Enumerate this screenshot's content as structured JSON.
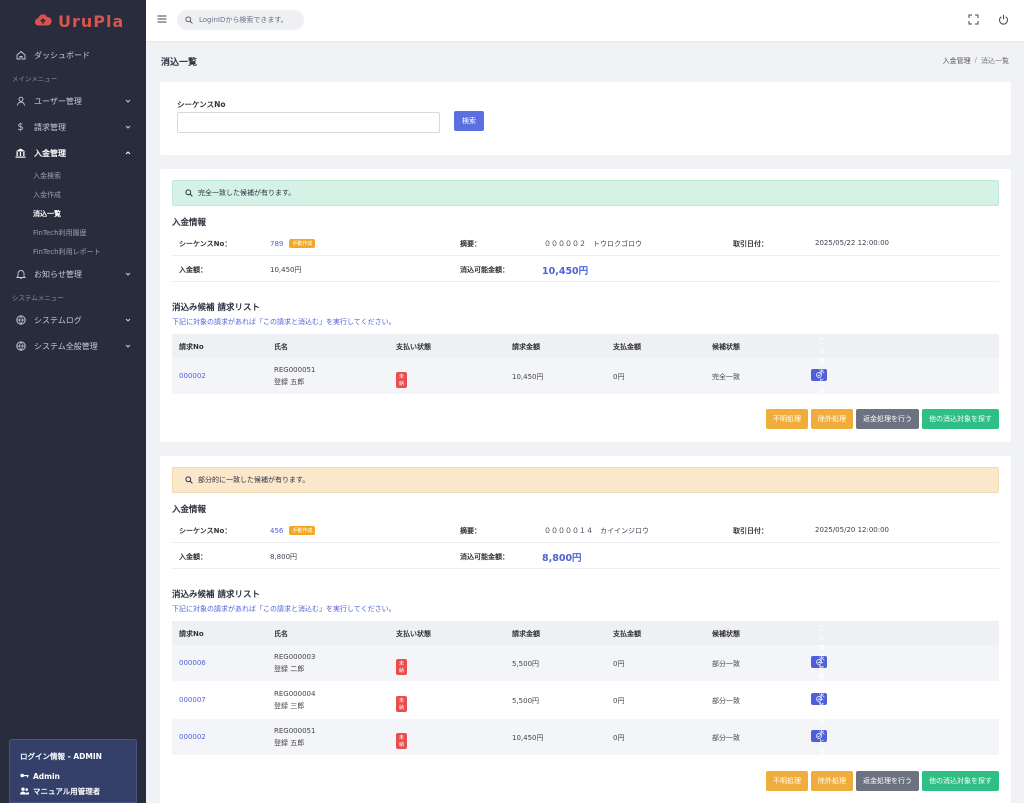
{
  "app": {
    "logo_text": "UruPla"
  },
  "sidebar": {
    "dashboard": "ダッシュボード",
    "section_main": "メインメニュー",
    "users": "ユーザー管理",
    "billing": "請求管理",
    "payments": "入金管理",
    "payments_sub": [
      "入金検索",
      "入金作成",
      "消込一覧",
      "FinTech利用履歴",
      "FinTech利用レポート"
    ],
    "notice": "お知らせ管理",
    "section_system": "システムメニュー",
    "syslog": "システムログ",
    "sysall": "システム全般管理",
    "login_title": "ログイン情報 - ADMIN",
    "login_user": "Admin",
    "login_role": "マニュアル用管理者"
  },
  "topbar": {
    "search_placeholder": "LoginIDから検索できます。"
  },
  "page": {
    "title": "消込一覧",
    "breadcrumb_parent": "入金管理",
    "breadcrumb_sep": "/",
    "breadcrumb_current": "消込一覧"
  },
  "search": {
    "label": "シーケンスNo",
    "button": "検索"
  },
  "common": {
    "info_title": "入金情報",
    "seq_label": "シーケンスNo：",
    "summary_label": "摘要：",
    "date_label": "取引日付：",
    "amount_label": "入金額：",
    "available_label": "消込可能金額：",
    "manual_badge": "手動作成",
    "list_title": "消込み候補  請求リスト",
    "list_note": "下記に対象の請求があれば「この請求と消込む」を実行してください。",
    "cols": [
      "請求No",
      "氏名",
      "支払い状態",
      "請求金額",
      "支払金額",
      "候補状態"
    ],
    "unpaid": "未納",
    "match_button": "この請求と消込む",
    "actions": [
      "不明処理",
      "除外処理",
      "返金処理を行う",
      "他の消込対象を探す"
    ]
  },
  "block1": {
    "alert": "完全一致した候補が有ります。",
    "seq": "789",
    "summary": "０００００２　トウロクゴロウ",
    "date": "2025/05/22 12:00:00",
    "amount": "10,450円",
    "available": "10,450円",
    "rows": [
      {
        "no": "000002",
        "code": "REG000051",
        "name": "登録 五郎",
        "billed": "10,450円",
        "paid": "0円",
        "status": "完全一致"
      }
    ]
  },
  "block2": {
    "alert": "部分的に一致した候補が有ります。",
    "seq": "456",
    "summary": "０００００１４　カイインジロウ",
    "date": "2025/05/20 12:00:00",
    "amount": "8,800円",
    "available": "8,800円",
    "rows": [
      {
        "no": "000006",
        "code": "REG000003",
        "name": "登録 二郎",
        "billed": "5,500円",
        "paid": "0円",
        "status": "部分一致"
      },
      {
        "no": "000007",
        "code": "REG000004",
        "name": "登録 三郎",
        "billed": "5,500円",
        "paid": "0円",
        "status": "部分一致"
      },
      {
        "no": "000002",
        "code": "REG000051",
        "name": "登録 五郎",
        "billed": "10,450円",
        "paid": "0円",
        "status": "部分一致"
      }
    ]
  }
}
